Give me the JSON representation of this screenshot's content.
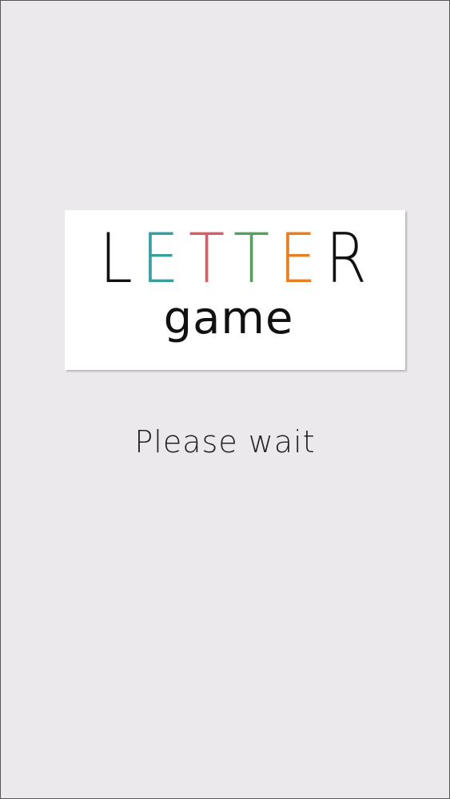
{
  "logo": {
    "letters": [
      {
        "char": "L",
        "color": "#111111"
      },
      {
        "char": "E",
        "color": "#3a9da0"
      },
      {
        "char": "T",
        "color": "#d85d66"
      },
      {
        "char": "T",
        "color": "#53a15d"
      },
      {
        "char": "E",
        "color": "#ea7d23"
      },
      {
        "char": "R",
        "color": "#111111"
      }
    ],
    "subtitle": "game"
  },
  "status_text": "Please wait"
}
